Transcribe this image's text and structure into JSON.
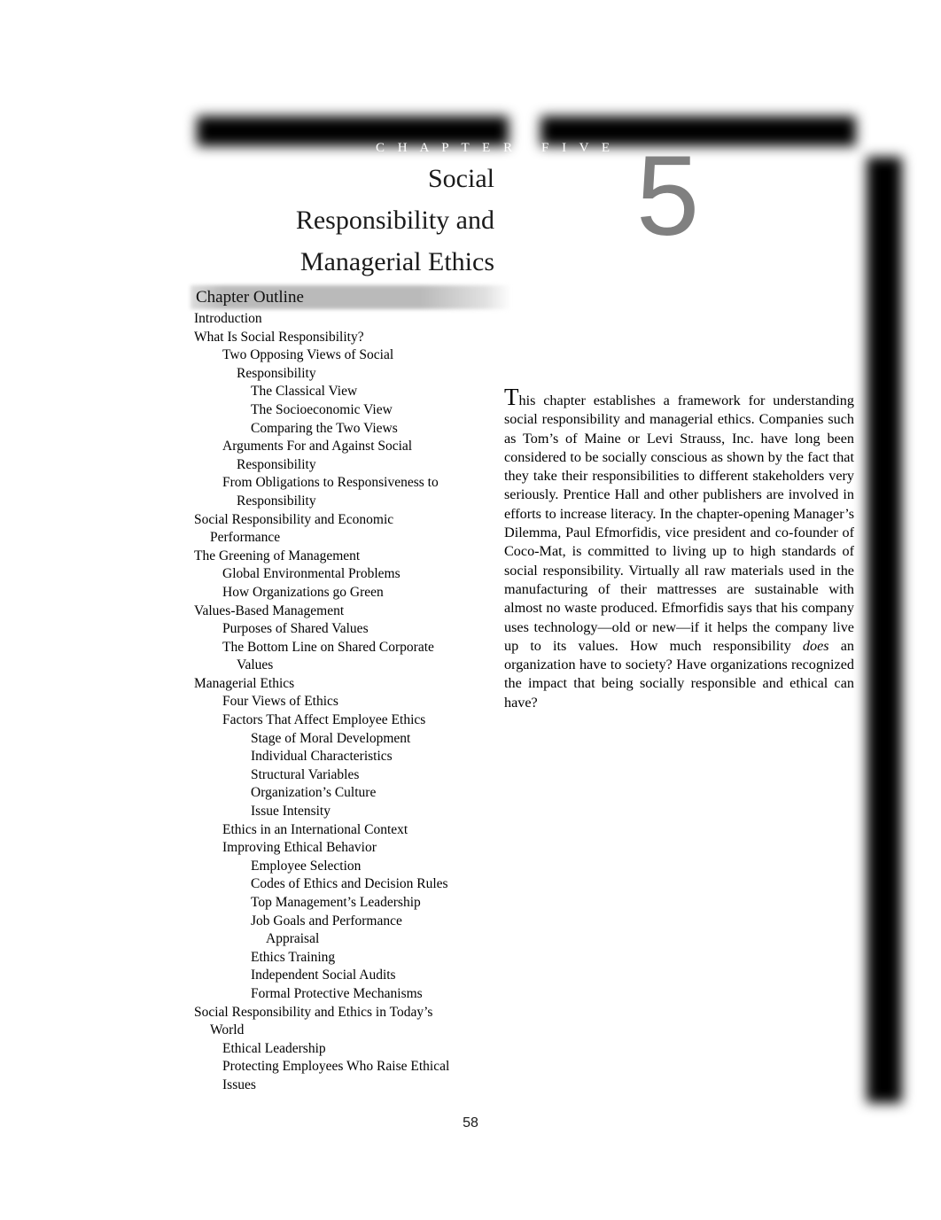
{
  "header": {
    "chapter_word": "C H A P T E R",
    "number_word": "F I V E",
    "chapter_number": "5",
    "title_line_1": "Social",
    "title_line_2": "Responsibility and",
    "title_line_3": "Managerial Ethics"
  },
  "outline": {
    "banner_label": "Chapter Outline",
    "items": [
      {
        "text": "Introduction",
        "level": 0
      },
      {
        "text": "What Is Social Responsibility?",
        "level": 0
      },
      {
        "text": "Two Opposing Views of Social",
        "level": 1
      },
      {
        "text": "Responsibility",
        "level": 1,
        "wrap": true
      },
      {
        "text": "The Classical View",
        "level": 2
      },
      {
        "text": "The Socioeconomic View",
        "level": 2
      },
      {
        "text": "Comparing the Two Views",
        "level": 2
      },
      {
        "text": "Arguments For and Against Social",
        "level": 1
      },
      {
        "text": "Responsibility",
        "level": 1,
        "wrap": true
      },
      {
        "text": "From Obligations to Responsiveness to",
        "level": 1
      },
      {
        "text": "Responsibility",
        "level": 1,
        "wrap": true
      },
      {
        "text": "Social Responsibility and Economic",
        "level": 0
      },
      {
        "text": "Performance",
        "level": 0,
        "wrap": true
      },
      {
        "text": "The Greening of Management",
        "level": 0
      },
      {
        "text": "Global Environmental Problems",
        "level": 1
      },
      {
        "text": "How Organizations go Green",
        "level": 1
      },
      {
        "text": "Values-Based Management",
        "level": 0
      },
      {
        "text": "Purposes of Shared Values",
        "level": 1
      },
      {
        "text": "The Bottom Line on Shared Corporate",
        "level": 1
      },
      {
        "text": "Values",
        "level": 1,
        "wrap": true
      },
      {
        "text": "Managerial Ethics",
        "level": 0
      },
      {
        "text": "Four Views of Ethics",
        "level": 1
      },
      {
        "text": "Factors That Affect Employee Ethics",
        "level": 1
      },
      {
        "text": "Stage of Moral Development",
        "level": 2
      },
      {
        "text": "Individual Characteristics",
        "level": 2
      },
      {
        "text": "Structural Variables",
        "level": 2
      },
      {
        "text": "Organization’s Culture",
        "level": 2
      },
      {
        "text": "Issue Intensity",
        "level": 2
      },
      {
        "text": "Ethics in an International Context",
        "level": 1
      },
      {
        "text": "Improving Ethical Behavior",
        "level": 1
      },
      {
        "text": "Employee Selection",
        "level": 2
      },
      {
        "text": "Codes of Ethics and Decision Rules",
        "level": 2
      },
      {
        "text": "Top Management’s Leadership",
        "level": 2
      },
      {
        "text": "Job Goals and Performance",
        "level": 2
      },
      {
        "text": "Appraisal",
        "level": 2,
        "wrap": true
      },
      {
        "text": "Ethics Training",
        "level": 2
      },
      {
        "text": "Independent Social Audits",
        "level": 2
      },
      {
        "text": "Formal Protective Mechanisms",
        "level": 2
      },
      {
        "text": "Social Responsibility and Ethics in Today’s",
        "level": 0
      },
      {
        "text": "World",
        "level": 0,
        "wrap": true
      },
      {
        "text": "Ethical Leadership",
        "level": 1
      },
      {
        "text": "Protecting Employees Who Raise Ethical",
        "level": 1
      },
      {
        "text": "Issues",
        "level": 1,
        "wrap": false
      }
    ]
  },
  "intro": {
    "dropcap": "T",
    "segment_1": "his chapter establishes a framework for understanding social responsibility and managerial ethics. Companies such as Tom’s of Maine or Levi Strauss, Inc. have long been considered to be socially conscious as shown by the fact that they take their responsibilities to different stakeholders very seriously. Prentice Hall and other publishers are involved in efforts to increase literacy. In the chapter-opening Manager’s Dilemma, Paul Efmorfidis, vice president and co-founder of Coco-Mat, is committed to living up to high standards of social responsibility.  Virtually all raw materials used in the manufacturing of their mattresses are sustainable with almost no waste produced. Efmorfidis says that his company uses technology—old or new—if it helps the company live up to its values.  How much responsibility ",
    "emphasis": "does",
    "segment_2": " an organization have to society? Have organizations recognized the impact that being socially responsible and ethical can have?"
  },
  "footer": {
    "page_number": "58"
  },
  "colors": {
    "bar_black": "#000000",
    "numeral_gray": "#808080",
    "banner_gray": "#b7b7b7",
    "text_black": "#000000",
    "page_white": "#ffffff"
  }
}
